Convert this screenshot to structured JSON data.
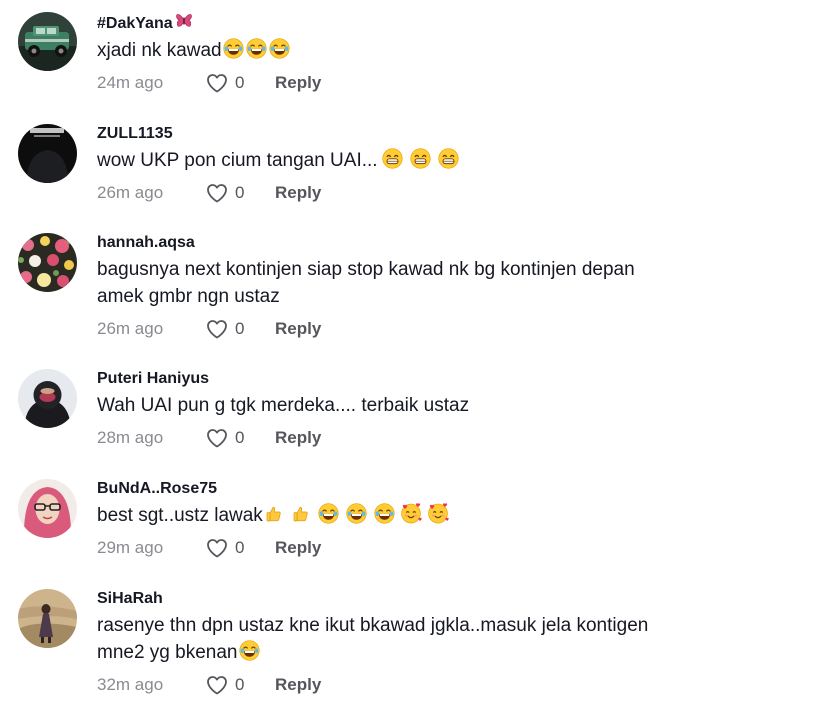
{
  "comments": [
    {
      "username": "#DakYana",
      "username_icon": "butterfly-icon",
      "text": "xjadi nk kawad",
      "emojis": [
        "laugh",
        "laugh",
        "laugh"
      ],
      "time": "24m ago",
      "likes": "0",
      "reply": "Reply"
    },
    {
      "username": "ZULL1135",
      "text": "wow UKP pon cium tangan UAI...",
      "emojis": [
        "grin",
        "grin",
        "grin"
      ],
      "time": "26m ago",
      "likes": "0",
      "reply": "Reply"
    },
    {
      "username": "hannah.aqsa",
      "text_line1": "bagusnya next kontinjen siap stop kawad nk bg kontinjen depan",
      "text_line2": "amek gmbr ngn ustaz",
      "time": "26m ago",
      "likes": "0",
      "reply": "Reply"
    },
    {
      "username": "Puteri Haniyus",
      "text": "Wah UAI pun g tgk merdeka.... terbaik ustaz",
      "time": "28m ago",
      "likes": "0",
      "reply": "Reply"
    },
    {
      "username": "BuNdA..Rose75",
      "text": "best sgt..ustz lawak",
      "emojis": [
        "thumbs-up",
        "thumbs-up",
        "laugh",
        "laugh",
        "laugh",
        "hearts",
        "hearts"
      ],
      "time": "29m ago",
      "likes": "0",
      "reply": "Reply"
    },
    {
      "username": "SiHaRah",
      "text_line1": "rasenye thn dpn ustaz kne ikut bkawad jgkla..masuk jela kontigen",
      "text_line2": "mne2 yg bkenan",
      "emojis": [
        "laugh"
      ],
      "time": "32m ago",
      "likes": "0",
      "reply": "Reply"
    }
  ],
  "colors": {
    "text": "#161823",
    "muted": "#8a8b91",
    "action": "#55565c",
    "emoji_face": "#FFCC33"
  }
}
